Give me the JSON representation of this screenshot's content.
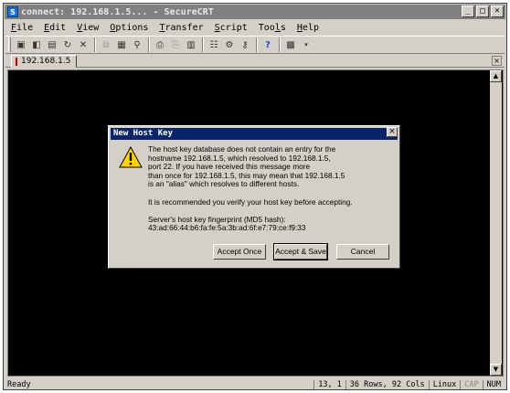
{
  "window": {
    "title": "connect: 192.168.1.5... - SecureCRT",
    "icon": "securecrt-app-icon",
    "controls": [
      "minimize",
      "maximize",
      "close"
    ]
  },
  "menu": [
    {
      "label": "File",
      "u": "F",
      "rest": "ile"
    },
    {
      "label": "Edit",
      "u": "E",
      "rest": "dit"
    },
    {
      "label": "View",
      "u": "V",
      "rest": "iew"
    },
    {
      "label": "Options",
      "u": "O",
      "rest": "ptions"
    },
    {
      "label": "Transfer",
      "u": "T",
      "rest": "ransfer"
    },
    {
      "label": "Script",
      "u": "S",
      "rest": "cript"
    },
    {
      "label": "Tools",
      "u": "l",
      "pre": "Too",
      "rest": "s"
    },
    {
      "label": "Help",
      "u": "H",
      "rest": "elp"
    }
  ],
  "toolbar": {
    "icons": [
      "connect-icon",
      "quick-connect-icon",
      "connect-tab-icon",
      "reconnect-icon",
      "disconnect-icon",
      "copy-icon",
      "paste-icon",
      "find-icon",
      "print-icon",
      "print-selection-icon",
      "print-setup-icon",
      "session-options-icon",
      "global-options-icon",
      "key-icon",
      "help-icon",
      "map-keys-icon"
    ]
  },
  "tab": {
    "label": "192.168.1.5"
  },
  "dialog": {
    "title": "New Host Key",
    "message_lines": [
      "The host key database does not contain an entry for the",
      "hostname 192.168.1.5, which resolved to 192.168.1.5,",
      "port 22.  If you have received this message more",
      "than once for 192.168.1.5, this may mean that 192.168.1.5",
      "is an \"alias\" which resolves to different hosts."
    ],
    "recommend": "It is recommended you verify your host key before accepting.",
    "fingerprint_label": "Server's host key fingerprint (MD5 hash):",
    "fingerprint": "43:ad:66:44:b6:fa:fe:5a:3b:ad:6f:e7:79:ce:f9:33",
    "buttons": {
      "accept_once": "Accept Once",
      "accept_save": "Accept & Save",
      "cancel": "Cancel"
    }
  },
  "status": {
    "ready": "Ready",
    "position": "13,  1",
    "size": "36 Rows, 92 Cols",
    "os": "Linux",
    "caps": "CAP",
    "num": "NUM"
  }
}
